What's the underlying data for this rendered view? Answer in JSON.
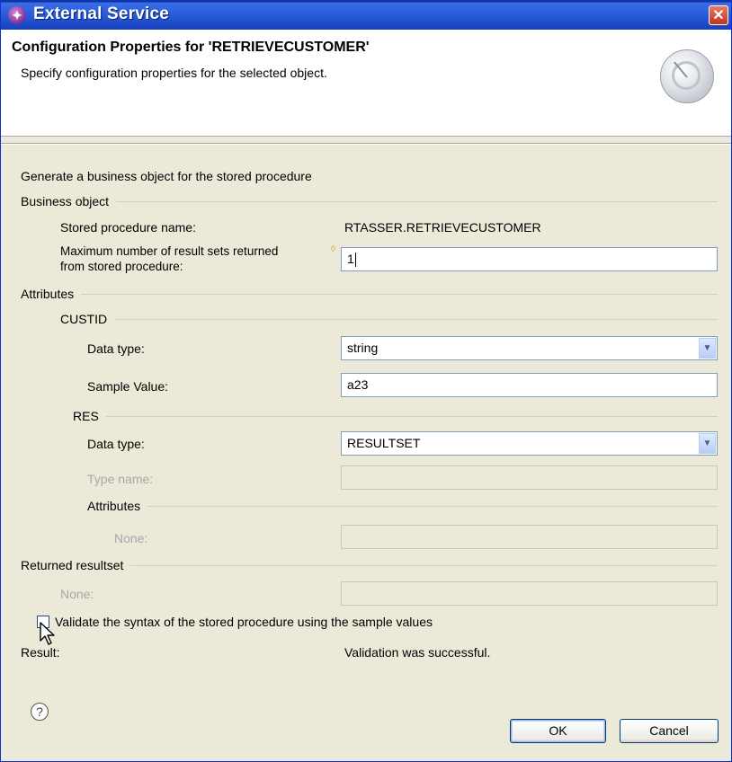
{
  "window": {
    "title": "External Service",
    "icon": "plug-icon",
    "close_label": "✕"
  },
  "header": {
    "title": "Configuration Properties for 'RETRIEVECUSTOMER'",
    "description": "Specify configuration properties for the selected object.",
    "icon": "wizard-dial-icon"
  },
  "content": {
    "intro": "Generate a business object for the stored procedure",
    "business_object": {
      "group_label": "Business object",
      "stored_proc_label": "Stored procedure name:",
      "stored_proc_value": "RTASSER.RETRIEVECUSTOMER",
      "max_result_sets_label_line1": "Maximum number of result sets returned",
      "max_result_sets_label_line2": "from stored procedure:",
      "max_result_sets_value": "1"
    },
    "attributes": {
      "group_label": "Attributes",
      "custid": {
        "group_label": "CUSTID",
        "data_type_label": "Data type:",
        "data_type_value": "string",
        "sample_value_label": "Sample Value:",
        "sample_value": "a23"
      },
      "res": {
        "group_label": "RES",
        "data_type_label": "Data type:",
        "data_type_value": "RESULTSET",
        "type_name_label": "Type name:",
        "type_name_value": "",
        "attributes_label": "Attributes",
        "none_label": "None:",
        "none_value": ""
      }
    },
    "returned_resultset": {
      "group_label": "Returned resultset",
      "none_label": "None:",
      "none_value": ""
    },
    "validate": {
      "label": "Validate the syntax of the stored procedure using the sample values",
      "checked": false
    },
    "result": {
      "label": "Result:",
      "value": "Validation was successful."
    }
  },
  "footer": {
    "help_label": "?",
    "ok_label": "OK",
    "cancel_label": "Cancel"
  }
}
